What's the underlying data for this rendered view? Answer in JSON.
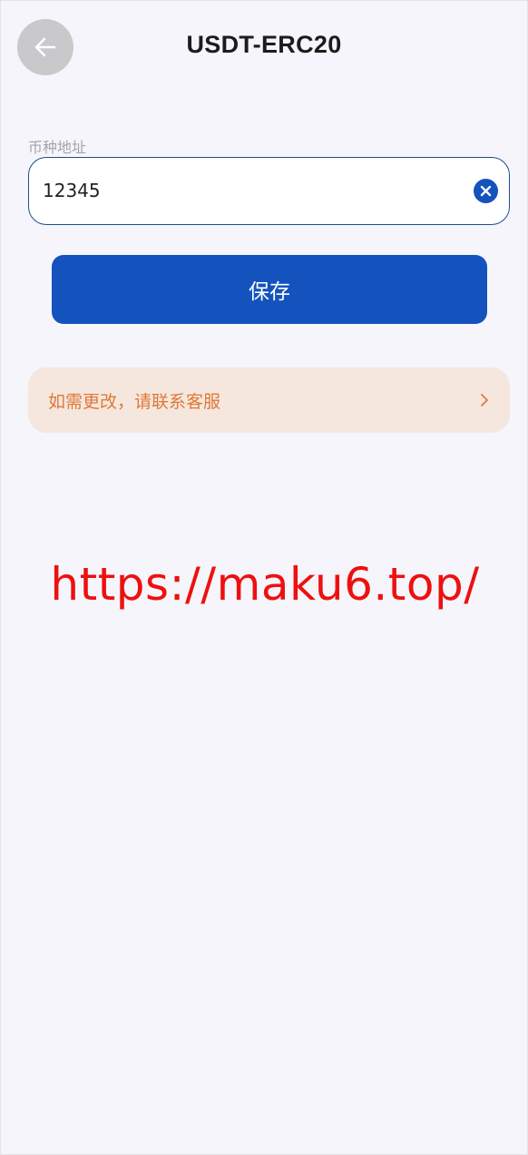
{
  "header": {
    "title": "USDT-ERC20",
    "back_icon": "arrow-left-icon"
  },
  "form": {
    "address_label": "币种地址",
    "address_value": "12345",
    "clear_icon": "close-circle-icon",
    "save_label": "保存"
  },
  "notice": {
    "text": "如需更改，请联系客服",
    "icon": "chevron-right-icon"
  },
  "watermark": "https://maku6.top/",
  "colors": {
    "primary": "#1452be",
    "notice_bg": "#f5e7de",
    "notice_text": "#e07838",
    "watermark": "#ee1010",
    "page_bg": "#f5f5fb"
  }
}
